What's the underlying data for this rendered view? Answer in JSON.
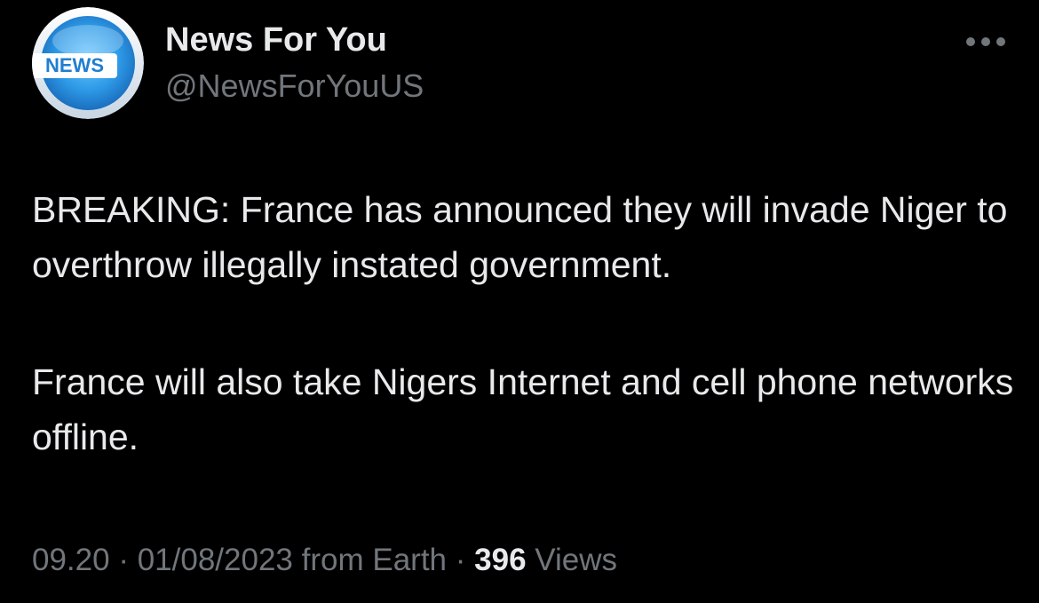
{
  "author": {
    "display_name": "News For You",
    "handle": "@NewsForYouUS",
    "avatar_text": "NEWS"
  },
  "more_icon": "more-horizontal-icon",
  "tweet": {
    "paragraphs": [
      "BREAKING: France has announced they will invade Niger to overthrow illegally instated government.",
      "France will also take Nigers Internet and cell phone networks offline."
    ]
  },
  "meta": {
    "time": "09.20",
    "separator": "·",
    "date": "01/08/2023",
    "source": "from Earth",
    "views_count": "396",
    "views_label": "Views"
  },
  "colors": {
    "background": "#000000",
    "primary_text": "#e7e9ea",
    "secondary_text": "#71767b",
    "avatar_blue": "#2e9be8"
  }
}
